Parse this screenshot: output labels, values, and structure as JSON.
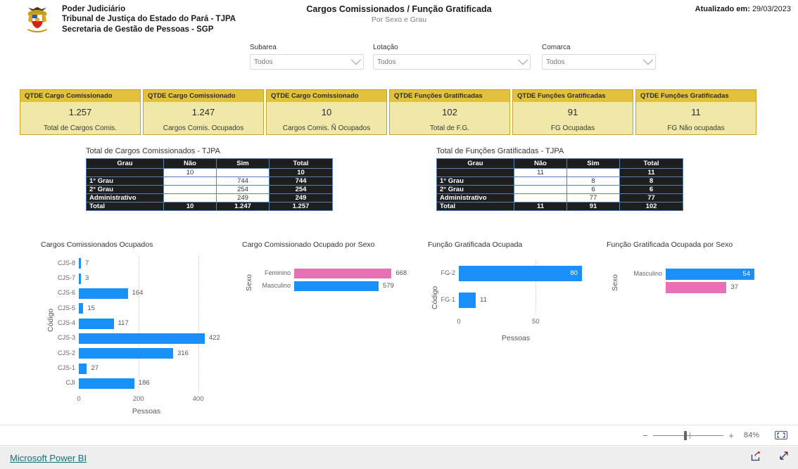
{
  "header": {
    "org_lines": [
      "Poder Judiciário",
      "Tribunal de Justiça do Estado do Pará - TJPA",
      "Secretaria de Gestão de Pessoas - SGP"
    ],
    "title": "Cargos Comissionados / Função Gratificada",
    "subtitle": "Por Sexo e Grau",
    "updated_label": "Atualizado em:",
    "updated_value": "29/03/2023",
    "logo_icon": "tjpa-coat-of-arms-icon"
  },
  "slicers": [
    {
      "label": "Subarea",
      "value": "Todos",
      "icon": "chevron-down-icon"
    },
    {
      "label": "Lotação",
      "value": "Todos",
      "icon": "chevron-down-icon"
    },
    {
      "label": "Comarca",
      "value": "Todos",
      "icon": "chevron-down-icon"
    }
  ],
  "kpi_cards": [
    {
      "head": "QTDE Cargo Comissionado",
      "value": "1.257",
      "sub": "Total de Cargos Comis."
    },
    {
      "head": "QTDE Cargo Comissionado",
      "value": "1.247",
      "sub": "Cargos Comis. Ocupados"
    },
    {
      "head": "QTDE Cargo Comissionado",
      "value": "10",
      "sub": "Cargos Comis. Ñ Ocupados"
    },
    {
      "head": "QTDE Funções Gratificadas",
      "value": "102",
      "sub": "Total de F.G."
    },
    {
      "head": "QTDE Funções Gratificadas",
      "value": "91",
      "sub": "FG Ocupadas"
    },
    {
      "head": "QTDE Funções Gratificadas",
      "value": "11",
      "sub": "FG Não ocupadas"
    }
  ],
  "matrices": [
    {
      "title": "Total de Cargos Comissionados - TJPA",
      "columns": [
        "Grau",
        "Não",
        "Sim",
        "Total"
      ],
      "rows": [
        {
          "label": "",
          "nao": "10",
          "sim": "",
          "total": "10"
        },
        {
          "label": "1° Grau",
          "nao": "",
          "sim": "744",
          "total": "744"
        },
        {
          "label": "2° Grau",
          "nao": "",
          "sim": "254",
          "total": "254"
        },
        {
          "label": "Administrativo",
          "nao": "",
          "sim": "249",
          "total": "249"
        }
      ],
      "total_row": {
        "label": "Total",
        "nao": "10",
        "sim": "1.247",
        "total": "1.257"
      }
    },
    {
      "title": "Total de Funções Gratificadas - TJPA",
      "columns": [
        "Grau",
        "Não",
        "Sim",
        "Total"
      ],
      "rows": [
        {
          "label": "",
          "nao": "11",
          "sim": "",
          "total": "11"
        },
        {
          "label": "1° Grau",
          "nao": "",
          "sim": "8",
          "total": "8"
        },
        {
          "label": "2° Grau",
          "nao": "",
          "sim": "6",
          "total": "6"
        },
        {
          "label": "Administrativo",
          "nao": "",
          "sim": "77",
          "total": "77"
        }
      ],
      "total_row": {
        "label": "Total",
        "nao": "11",
        "sim": "91",
        "total": "102"
      }
    }
  ],
  "chart_data": [
    {
      "id": "cargos-comissionados-ocupados",
      "type": "bar",
      "orientation": "horizontal",
      "title": "Cargos Comissionados Ocupados",
      "xlabel": "Pessoas",
      "ylabel": "Código",
      "categories": [
        "CJS-8",
        "CJS-7",
        "CJS-6",
        "CJS-5",
        "CJS-4",
        "CJS-3",
        "CJS-2",
        "CJS-1",
        "CJI"
      ],
      "values": [
        7,
        3,
        164,
        15,
        117,
        422,
        316,
        27,
        186
      ],
      "value_labels": [
        "7",
        "3",
        "164",
        "15",
        "117",
        "422",
        "316",
        "27",
        "186"
      ],
      "xlim": [
        0,
        460
      ],
      "xticks": [
        0,
        200,
        400
      ],
      "xtick_labels": [
        "0",
        "200",
        "400"
      ],
      "grid": true,
      "color": "#1890f8",
      "legend": "none"
    },
    {
      "id": "cargo-comissionado-ocupado-por-sexo",
      "type": "bar",
      "orientation": "horizontal",
      "title": "Cargo Comissionado Ocupado por Sexo",
      "xlabel": "",
      "ylabel": "Sexo",
      "categories": [
        "Feminino",
        "Masculino"
      ],
      "values": [
        668,
        579
      ],
      "value_labels": [
        "668",
        "579"
      ],
      "colors": [
        "#e870b4",
        "#1890f8"
      ],
      "xlim": [
        0,
        700
      ],
      "xticks": [],
      "xtick_labels": [],
      "grid": false,
      "legend": "none"
    },
    {
      "id": "funcao-gratificada-ocupada",
      "type": "bar",
      "orientation": "horizontal",
      "title": "Função Gratificada Ocupada",
      "xlabel": "Pessoas",
      "ylabel": "Código",
      "categories": [
        "FG-2",
        "FG-1"
      ],
      "values": [
        80,
        11
      ],
      "value_labels": [
        "80",
        "11"
      ],
      "xlim": [
        0,
        86
      ],
      "xticks": [
        0,
        50
      ],
      "xtick_labels": [
        "0",
        "50"
      ],
      "grid": true,
      "color": "#1890f8",
      "legend": "none"
    },
    {
      "id": "funcao-gratificada-ocupada-por-sexo",
      "type": "bar",
      "orientation": "horizontal",
      "title": "Função Gratificada Ocupada por Sexo",
      "xlabel": "",
      "ylabel": "Sexo",
      "categories": [
        "Masculino",
        ""
      ],
      "values": [
        54,
        37
      ],
      "value_labels": [
        "54",
        "37"
      ],
      "colors": [
        "#1890f8",
        "#e870b4"
      ],
      "xlim": [
        0,
        60
      ],
      "xticks": [],
      "xtick_labels": [],
      "grid": false,
      "legend": "none"
    }
  ],
  "toolbar": {
    "zoom_minus": "−",
    "zoom_plus": "+",
    "zoom_percent": "84%",
    "fit_icon": "fit-to-page-icon"
  },
  "footer": {
    "brand": "Microsoft Power BI",
    "share_icon": "share-icon",
    "fullscreen_icon": "fullscreen-icon"
  }
}
